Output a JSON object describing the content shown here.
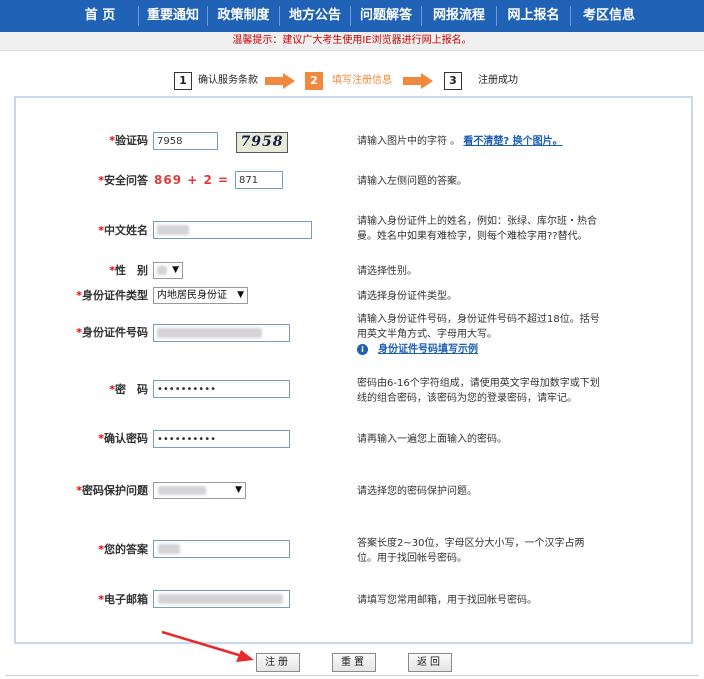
{
  "nav": {
    "items": [
      {
        "label": "首 页"
      },
      {
        "label": "重要通知"
      },
      {
        "label": "政策制度"
      },
      {
        "label": "地方公告"
      },
      {
        "label": "问题解答"
      },
      {
        "label": "网报流程"
      },
      {
        "label": "网上报名"
      },
      {
        "label": "考区信息"
      }
    ]
  },
  "tip": {
    "text": "温馨提示：建议广大考生使用IE浏览器进行网上报名。"
  },
  "steps": [
    {
      "num": "1",
      "label": "确认服务条款"
    },
    {
      "num": "2",
      "label": "填写注册信息"
    },
    {
      "num": "3",
      "label": "注册成功"
    }
  ],
  "form": {
    "required_mark": "*",
    "captcha": {
      "label": "验证码",
      "value": "7958",
      "image_text": "7958",
      "hint": "请输入图片中的字符 。",
      "link": "看不清楚? 换个图片。"
    },
    "security": {
      "label": "安全问答",
      "question": "869 + 2 =",
      "value": "871",
      "hint": "请输入左侧问题的答案。"
    },
    "name": {
      "label": "中文姓名",
      "hint": "请输入身份证件上的姓名，例如：张绿、库尔班・热合曼。姓名中如果有难检字，则每个难检字用??替代。"
    },
    "gender": {
      "label": "性　别",
      "hint": "请选择性别。"
    },
    "id_type": {
      "label": "身份证件类型",
      "selected": "内地居民身份证",
      "hint": "请选择身份证件类型。"
    },
    "id_number": {
      "label": "身份证件号码",
      "hint": "请输入身份证件号码，身份证件号码不超过18位。括号用英文半角方式、字母用大写。",
      "link": "身份证件号码填写示例"
    },
    "password": {
      "label": "密　码",
      "value": "••••••••••",
      "hint": "密码由6-16个字符组成，请使用英文字母加数字或下划线的组合密码，该密码为您的登录密码，请牢记。"
    },
    "confirm": {
      "label": "确认密码",
      "value": "••••••••••",
      "hint": "请再输入一遍您上面输入的密码。"
    },
    "question": {
      "label": "密码保护问题",
      "hint": "请选择您的密码保护问题。"
    },
    "answer": {
      "label": "您的答案",
      "hint": "答案长度2~30位，字母区分大小写，一个汉字占两位。用于找回帐号密码。"
    },
    "email": {
      "label": "电子邮箱",
      "hint": "请填写您常用邮箱，用于找回帐号密码。"
    }
  },
  "buttons": {
    "register": "注册",
    "reset": "重置",
    "back": "返回"
  },
  "colors": {
    "nav_bg": "#1f62b6",
    "accent": "#f0883e",
    "required": "#e00000",
    "link": "#1e5fb5"
  }
}
